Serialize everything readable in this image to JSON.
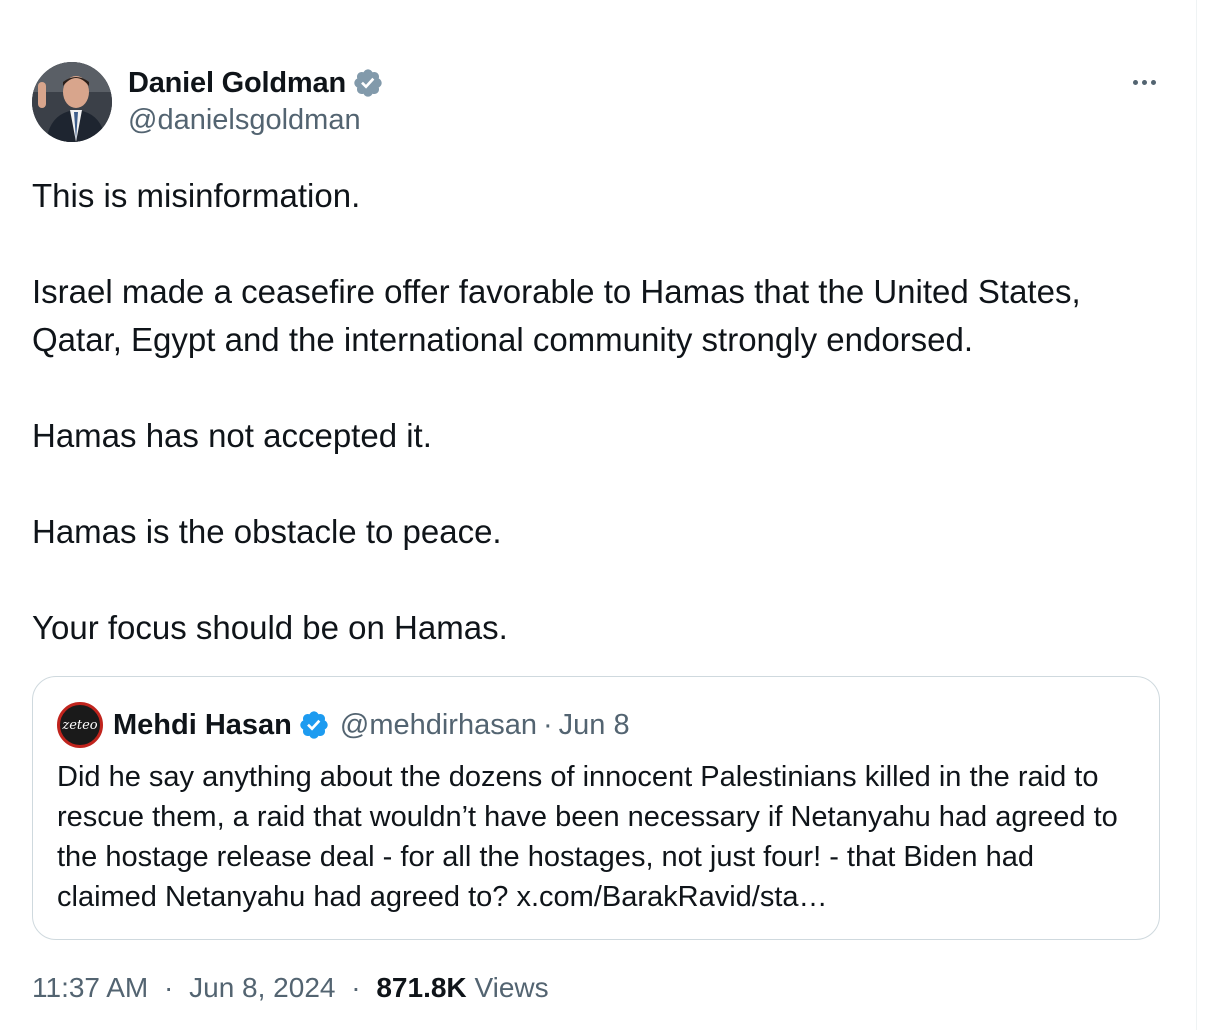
{
  "tweet": {
    "author": {
      "display_name": "Daniel Goldman",
      "handle": "@danielsgoldman",
      "verified_color": "#829aab",
      "avatar_icon": "profile-photo"
    },
    "paragraphs": [
      "This is misinformation.",
      "Israel made a ceasefire offer favorable to Hamas that the United States, Qatar, Egypt and the international community strongly endorsed.",
      "Hamas has not accepted it.",
      "Hamas is the obstacle to peace.",
      "Your focus should be on Hamas."
    ],
    "more_icon": "more-horizontal-icon"
  },
  "quote": {
    "avatar_text": "zeteo",
    "display_name": "Mehdi Hasan",
    "handle": "@mehdirhasan",
    "separator": "·",
    "date": "Jun 8",
    "verified_color": "#1d9bf0",
    "text": "Did he say anything about the dozens of innocent Palestinians killed in the raid to rescue them, a raid that wouldn’t have been necessary if Netanyahu had agreed to the hostage release deal - for all the hostages, not just four! - that Biden had claimed Netanyahu had agreed to? x.com/BarakRavid/sta…"
  },
  "meta": {
    "time": "11:37 AM",
    "separator": "·",
    "date": "Jun 8, 2024",
    "views_count": "871.8K",
    "views_label": "Views"
  }
}
